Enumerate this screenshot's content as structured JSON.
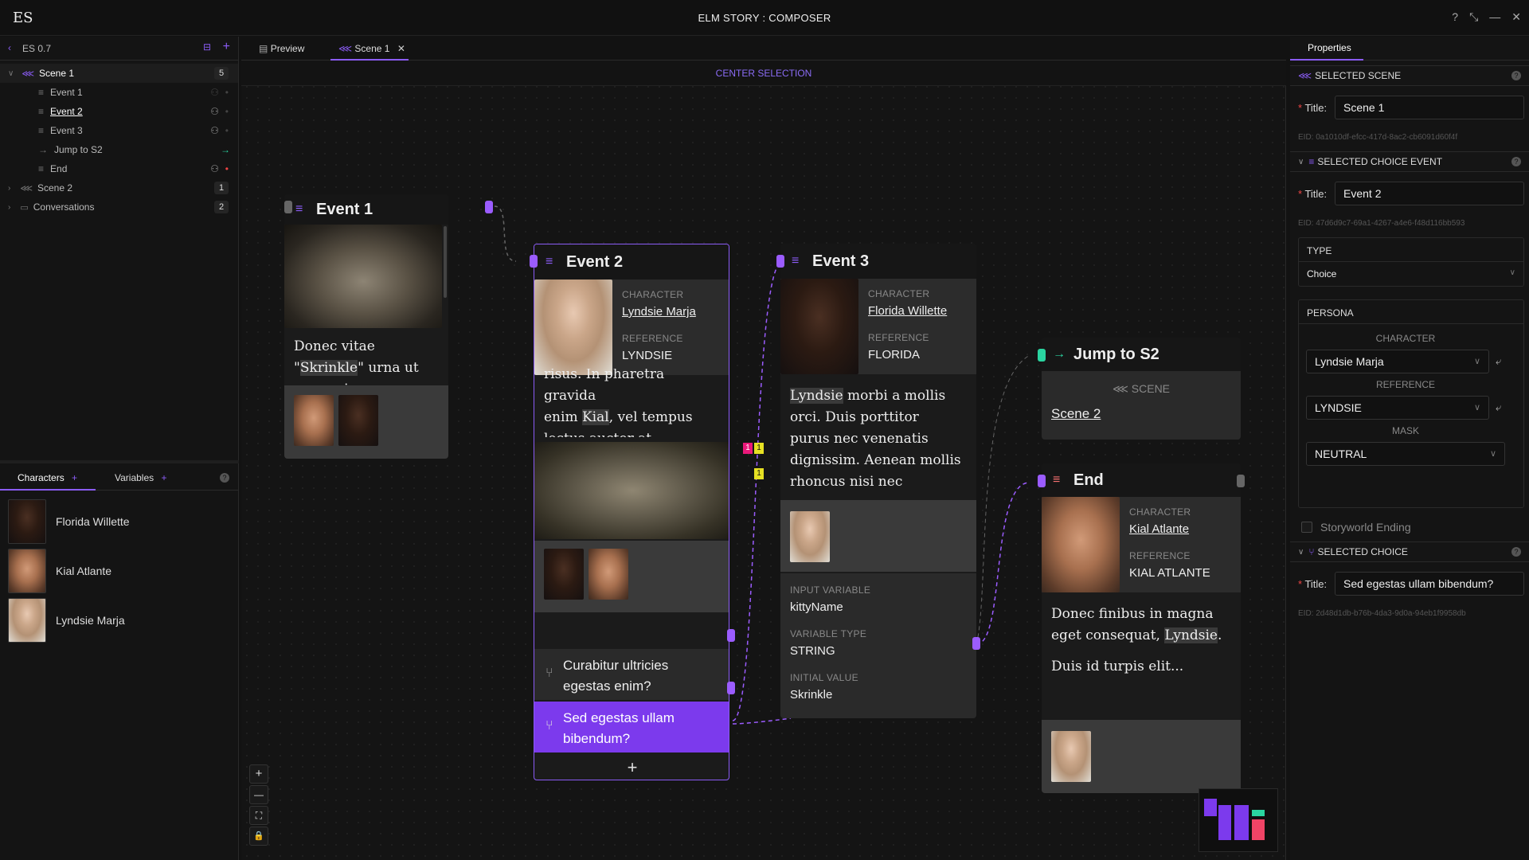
{
  "app": {
    "logo": "ES",
    "title": "ELM STORY : COMPOSER",
    "window_controls": [
      "?",
      "⤡",
      "—",
      "✕"
    ]
  },
  "left": {
    "project": "ES 0.7",
    "tree": [
      {
        "label": "Scene 1",
        "count": "5"
      },
      {
        "label": "Event 1"
      },
      {
        "label": "Event 2"
      },
      {
        "label": "Event 3"
      },
      {
        "label": "Jump to S2"
      },
      {
        "label": "End"
      },
      {
        "label": "Scene 2",
        "count": "1"
      },
      {
        "label": "Conversations",
        "count": "2"
      }
    ],
    "tabs": {
      "characters": "Characters",
      "variables": "Variables"
    },
    "characters": [
      {
        "name": "Florida Willette"
      },
      {
        "name": "Kial Atlante"
      },
      {
        "name": "Lyndsie Marja"
      }
    ]
  },
  "center": {
    "tabs": {
      "preview": "Preview",
      "scene": "Scene 1"
    },
    "center_selection": "CENTER SELECTION",
    "event1": {
      "title": "Event 1",
      "text_a": "Donec vitae \"",
      "text_hl": "Skrinkle",
      "text_b": "\" urna ut quam viverra"
    },
    "event2": {
      "title": "Event 2",
      "character_label": "CHARACTER",
      "character": "Lyndsie Marja",
      "reference_label": "REFERENCE",
      "reference": "LYNDSIE",
      "text_top": "risus. In pharetra gravida",
      "text_a": "enim ",
      "text_hl": "Kial",
      "text_b": ", vel tempus lectus auctor at.",
      "choice1": "Curabitur ultricies egestas enim?",
      "choice2": "Sed egestas ullam bibendum?",
      "add": "+"
    },
    "event3": {
      "title": "Event 3",
      "character_label": "CHARACTER",
      "character": "Florida Willette",
      "reference_label": "REFERENCE",
      "reference": "FLORIDA",
      "text_hl": "Lyndsie",
      "text_b": " morbi a mollis orci. Duis porttitor purus nec venenatis dignissim. Aenean mollis rhoncus nisi nec accumsan.",
      "input_var_label": "INPUT VARIABLE",
      "input_var": "kittyName",
      "var_type_label": "VARIABLE TYPE",
      "var_type": "STRING",
      "init_label": "INITIAL VALUE",
      "init": "Skrinkle"
    },
    "jump": {
      "title": "Jump to S2",
      "scene_label": "SCENE",
      "scene": "Scene 2"
    },
    "end": {
      "title": "End",
      "character_label": "CHARACTER",
      "character": "Kial Atlante",
      "reference_label": "REFERENCE",
      "reference": "KIAL ATLANTE",
      "text_a": "Donec finibus in magna eget consequat, ",
      "text_hl": "Lyndsie",
      "text_b": ".",
      "text2": "Duis id turpis elit..."
    },
    "badges": {
      "b1": "1",
      "b2": "1",
      "b3": "1"
    },
    "zoom": [
      "+",
      "—",
      "⛶",
      "🔒"
    ]
  },
  "right": {
    "tab": "Properties",
    "selected_scene": "SELECTED SCENE",
    "title_label": "Title:",
    "scene_title": "Scene 1",
    "scene_eid": "EID: 0a1010df-efcc-417d-8ac2-cb6091d60f4f",
    "selected_choice_event": "SELECTED CHOICE EVENT",
    "event_title": "Event 2",
    "event_eid": "EID: 47d6d9c7-69a1-4267-a4e6-f48d116bb593",
    "type_label": "TYPE",
    "type_value": "Choice",
    "persona_label": "PERSONA",
    "character_label": "CHARACTER",
    "character_value": "Lyndsie Marja",
    "reference_label": "REFERENCE",
    "reference_value": "LYNDSIE",
    "mask_label": "MASK",
    "mask_value": "NEUTRAL",
    "storyworld_ending": "Storyworld Ending",
    "selected_choice": "SELECTED CHOICE",
    "choice_title": "Sed egestas ullam bibendum?",
    "choice_eid": "EID: 2d48d1db-b76b-4da3-9d0a-94eb1f9958db"
  },
  "colors": {
    "accent": "#8b5cf6",
    "choice_bg": "#7c3aed",
    "jump": "#2ad4a0",
    "end": "#f87171"
  }
}
